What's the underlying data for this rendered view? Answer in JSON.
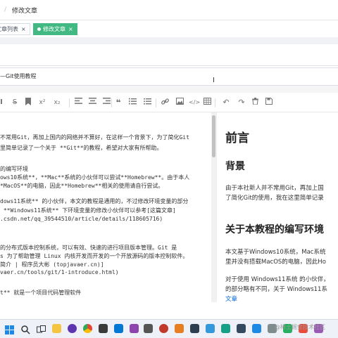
{
  "breadcrumb": {
    "separator": "/",
    "current": "修改文章"
  },
  "tags": [
    {
      "label": "文章列表",
      "close": "×",
      "active": false
    },
    {
      "label": "修改文章",
      "close": "×",
      "active": true
    }
  ],
  "title_input": {
    "value": "—Git使用教程"
  },
  "toolbar": {
    "icons": [
      "bold-icon",
      "strikethrough-icon",
      "bookmark-icon",
      "superscript-icon",
      "subscript-icon",
      "quote-icon",
      "ordered-list-icon",
      "unordered-list-icon",
      "link-icon",
      "image-icon",
      "code-icon",
      "table-icon",
      "undo-icon",
      "redo-icon",
      "trash-icon",
      "save-icon"
    ]
  },
  "editor": {
    "lines": [
      "不常用Git，再加上国内的网络并不算好，在这样一个背景下，为了简化Git",
      "里简单记录了一个关于 **Git**的教程，希望对大家有所帮助。",
      "",
      "的编写环境",
      "ows10系统**，**Mac**系统的小伙伴可以尝试**Homebrew**。由于本人",
      "*MacOS**的电脑，因此**Homebrew**相关的使用请自行尝试。",
      "",
      "dows11系统** 的小伙伴，本文的教程是通用的，不过修改环境变量的部分",
      " **Windows11系统** 下环境变量的修改小伙伴可以参考[这篇文章]",
      ".csdn.net/qq_39544510/article/details/118605716)",
      "",
      "",
      "的分布式版本控制系统，可以有效、快速的进行项目版本管理。Git 是",
      "s 为了帮助管理 Linux 内核开发而开发的一个开放源码的版本控制软件。",
      "简介 | 程序员大彬 (topjavaer.cn)]",
      "vaer.cn/tools/git/1-introduce.html)",
      "",
      "t** 就是一个项目代码管理软件"
    ]
  },
  "preview": {
    "h1": "前言",
    "h2_background": "背景",
    "p_background_1": "由于本社新人并不常用Git，再加上国",
    "p_background_2": "了简化Git的使用，我在这里简单记录",
    "h2_env": "关于本教程的编写环境",
    "p_env_1": "本文基于Windows10系统，Mac系统",
    "p_env_2": "里并没有搭载MacOS的电脑，因此Ho",
    "p_win11_1": "对于使用 Windows11系统 的小伙伴，",
    "p_win11_2": "的部分略有不同，关于 Windows11系",
    "p_win11_3": "文章"
  },
  "taskbar": {
    "icons": [
      "windows-start-icon",
      "search-icon",
      "task-view-icon",
      "file-explorer-icon",
      "chrome-icon",
      "app-icon",
      "terminal-icon",
      "app-icon",
      "app-icon",
      "app-icon",
      "app-icon",
      "app-icon",
      "vscode-icon",
      "app-icon",
      "app-icon"
    ],
    "watermark": "@稀土掘金技术社区"
  }
}
